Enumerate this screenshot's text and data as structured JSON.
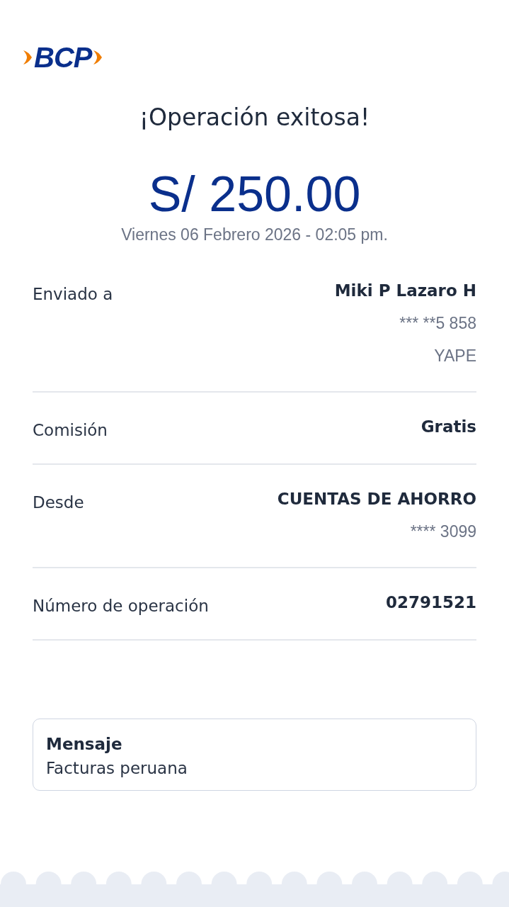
{
  "logo": {
    "text": "BCP"
  },
  "title": "¡Operación exitosa!",
  "amount": "S/ 250.00",
  "date": "Viernes 06 Febrero 2026 - 02:05 pm.",
  "details": [
    {
      "label": "Enviado a",
      "value": "Miki P Lazaro H",
      "extra": [
        "*** **5 858",
        "YAPE"
      ]
    },
    {
      "label": "Comisión",
      "value": "Gratis"
    },
    {
      "label": "Desde",
      "value": "CUENTAS DE AHORRO",
      "extra": [
        "**** 3099"
      ]
    },
    {
      "label": "Número de operación",
      "value": "02791521"
    }
  ],
  "message": {
    "title": "Mensaje",
    "text": "Facturas peruana"
  }
}
